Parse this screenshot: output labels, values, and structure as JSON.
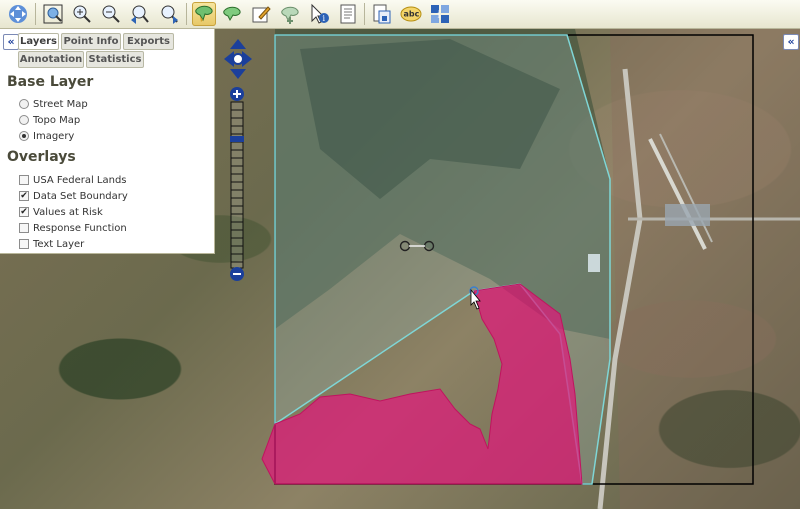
{
  "toolbar": {
    "buttons": [
      {
        "name": "pan-tool",
        "icon": "move-icon"
      },
      {
        "name": "zoom-extent",
        "icon": "globe-zoom-icon"
      },
      {
        "name": "zoom-in",
        "icon": "zoom-in-icon"
      },
      {
        "name": "zoom-out",
        "icon": "zoom-out-icon"
      },
      {
        "name": "zoom-previous",
        "icon": "zoom-previous-icon"
      },
      {
        "name": "zoom-next",
        "icon": "zoom-next-icon"
      },
      {
        "name": "area-tool",
        "icon": "polygon-select-icon"
      },
      {
        "name": "area-tool-2",
        "icon": "polygon-draw-icon"
      },
      {
        "name": "edit-area",
        "icon": "edit-area-icon"
      },
      {
        "name": "area-tool-3",
        "icon": "polygon-split-icon"
      },
      {
        "name": "identify",
        "icon": "identify-icon"
      },
      {
        "name": "report",
        "icon": "report-icon"
      },
      {
        "name": "export",
        "icon": "export-icon"
      },
      {
        "name": "label",
        "icon": "abc-label-icon",
        "label": "abc"
      },
      {
        "name": "info",
        "icon": "info-icon"
      }
    ]
  },
  "panel": {
    "tabs": [
      "Layers",
      "Point Info",
      "Exports",
      "Annotation",
      "Statistics"
    ],
    "active_tab": "Layers",
    "base_layer_title": "Base Layer",
    "base_layers": [
      {
        "label": "Street Map",
        "selected": false
      },
      {
        "label": "Topo Map",
        "selected": false
      },
      {
        "label": "Imagery",
        "selected": true
      }
    ],
    "overlays_title": "Overlays",
    "overlays": [
      {
        "label": "USA Federal Lands",
        "checked": false
      },
      {
        "label": "Data Set Boundary",
        "checked": true
      },
      {
        "label": "Values at Risk",
        "checked": true
      },
      {
        "label": "Response Function",
        "checked": false
      },
      {
        "label": "Text Layer",
        "checked": false
      }
    ]
  },
  "map": {
    "dataset_boundary_color": "#000000",
    "values_at_risk_color": "#e0177a",
    "selection_outline_color": "#7fd6d6"
  },
  "colors": {
    "toolbar": "#f1f0dc",
    "nav_blue": "#1b3f9b"
  }
}
